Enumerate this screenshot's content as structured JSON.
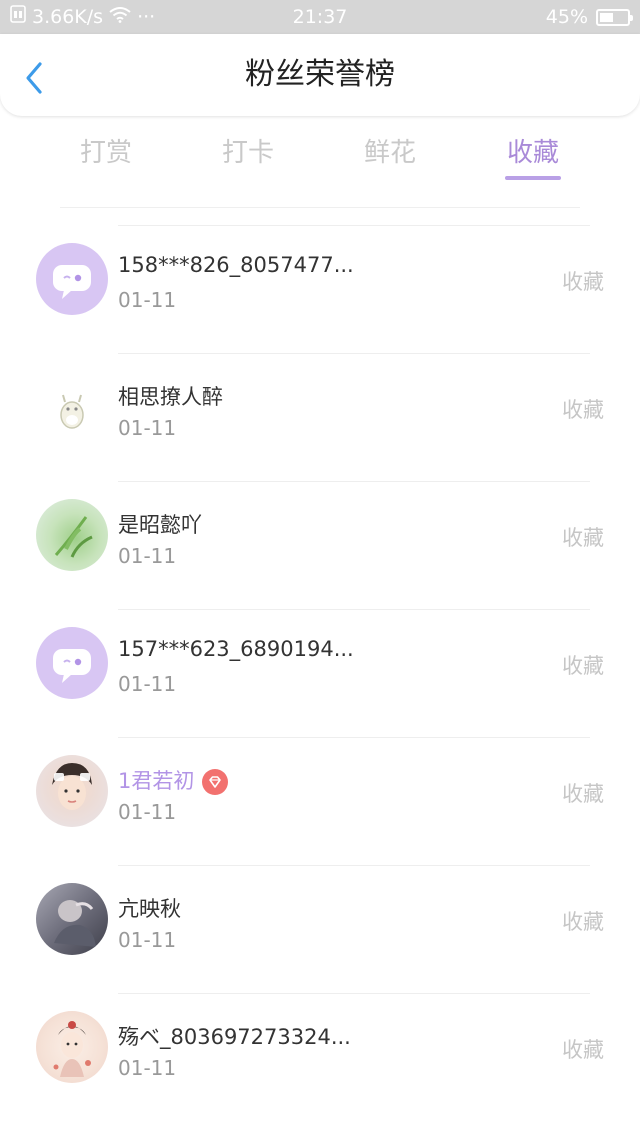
{
  "status_bar": {
    "network_speed": "3.66K/s",
    "more": "···",
    "time": "21:37",
    "battery": "45%",
    "battery_level": 0.45
  },
  "header": {
    "title": "粉丝荣誉榜"
  },
  "tabs": [
    {
      "label": "打赏",
      "active": false
    },
    {
      "label": "打卡",
      "active": false
    },
    {
      "label": "鲜花",
      "active": false
    },
    {
      "label": "收藏",
      "active": true
    }
  ],
  "accent_color": "#b294e6",
  "list": [
    {
      "name": "158***826_8057477...",
      "date": "01-11",
      "action": "收藏",
      "avatar": "default-chat-avatar"
    },
    {
      "name": "相思撩人醉",
      "date": "01-11",
      "action": "收藏",
      "avatar": "totoro-avatar"
    },
    {
      "name": "是昭懿吖",
      "date": "01-11",
      "action": "收藏",
      "avatar": "plant-photo-avatar"
    },
    {
      "name": "157***623_6890194...",
      "date": "01-11",
      "action": "收藏",
      "avatar": "default-chat-avatar"
    },
    {
      "name": "1君若初",
      "date": "01-11",
      "action": "收藏",
      "avatar": "person-photo-avatar",
      "badge": "diamond-icon"
    },
    {
      "name": "亢映秋",
      "date": "01-11",
      "action": "收藏",
      "avatar": "person-photo-avatar"
    },
    {
      "name": "殇ベ_803697273324...",
      "date": "01-11",
      "action": "收藏",
      "avatar": "costume-photo-avatar"
    }
  ]
}
